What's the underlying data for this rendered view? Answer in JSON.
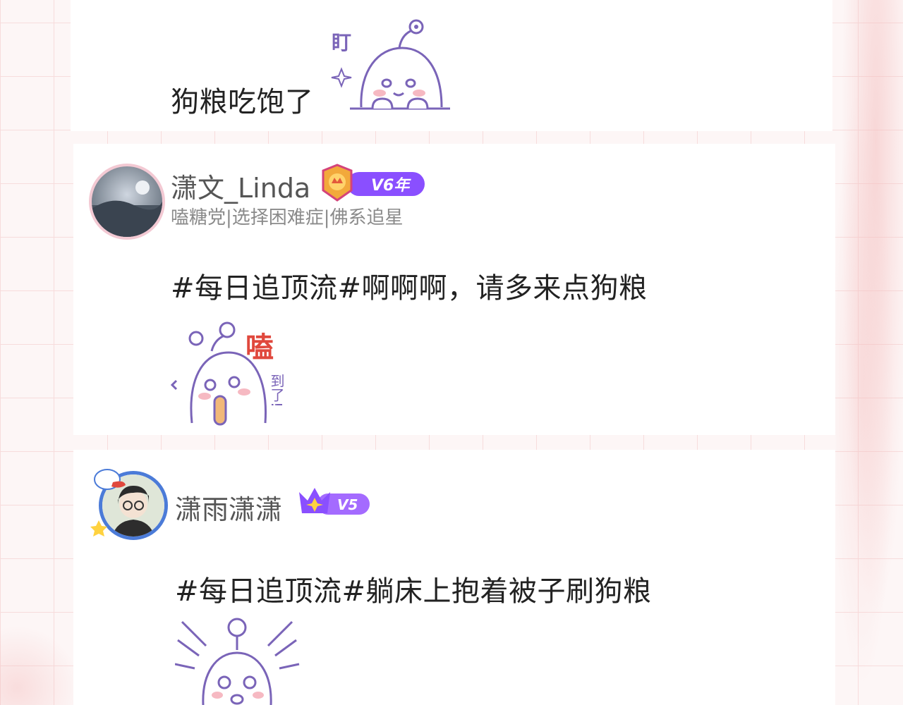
{
  "posts": [
    {
      "text": "狗粮吃饱了",
      "sticker": {
        "name": "staring-seal-sticker",
        "caption": "盯"
      }
    },
    {
      "user": {
        "name": "潇文_Linda",
        "level_badge": "V6年",
        "bio": "嗑糖党|选择困难症|佛系追星"
      },
      "text": "#每日追顶流#啊啊啊，请多来点狗粮",
      "sticker": {
        "name": "shipping-seal-sticker",
        "caption_top": "嗑",
        "caption_bottom": "到了!"
      }
    },
    {
      "user": {
        "name": "潇雨潇潇",
        "level_badge": "V5"
      },
      "text": "#每日追顶流#躺床上抱着被子刷狗粮",
      "sticker": {
        "name": "shocked-seal-sticker"
      }
    }
  ],
  "colors": {
    "background": "#fdf6f6",
    "grid": "#f7dcdc",
    "card": "#ffffff",
    "badge_purple": "#8a4fff",
    "badge_gold": "#f2a93b",
    "sticker_line": "#7a64b8",
    "sticker_accent": "#e0483d"
  }
}
